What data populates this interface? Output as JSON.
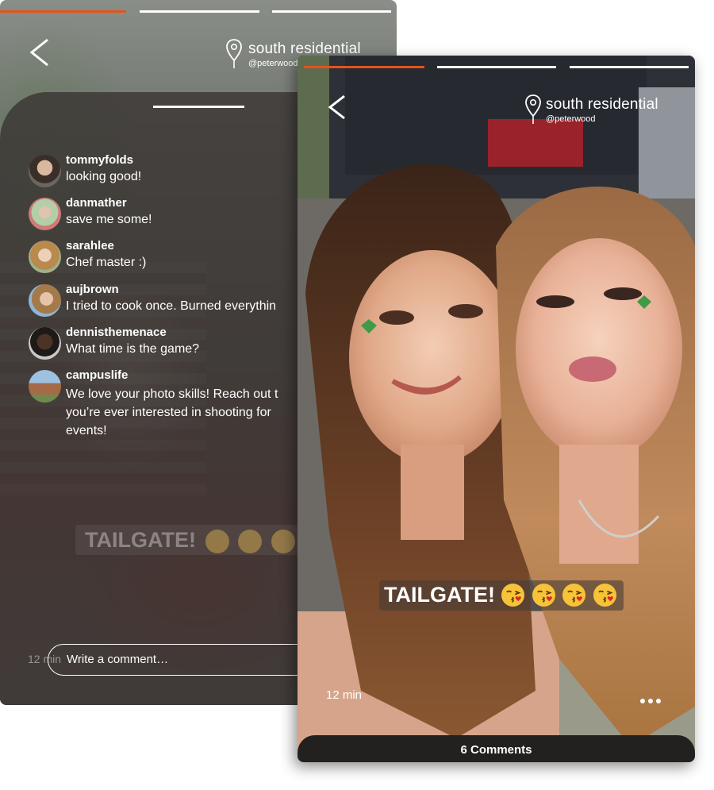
{
  "back_card": {
    "location": {
      "title": "south residential",
      "user": "@peterwood"
    },
    "comments": [
      {
        "username": "tommyfolds",
        "text": "looking good!"
      },
      {
        "username": "danmather",
        "text": "save me some!"
      },
      {
        "username": "sarahlee",
        "text": "Chef master :)"
      },
      {
        "username": "aujbrown",
        "text": "I tried to cook once. Burned everythin"
      },
      {
        "username": "dennisthemenace",
        "text": "What time is the game?"
      },
      {
        "username": "campuslife",
        "text": "We love your photo skills! Reach out t you’re ever interested in shooting for events!"
      }
    ],
    "caption_ghost": "TAILGATE!",
    "time": "12 min",
    "comment_input": {
      "placeholder": "Write a comment…"
    }
  },
  "front_card": {
    "location": {
      "title": "south residential",
      "user": "@peterwood"
    },
    "caption": {
      "text": "TAILGATE!",
      "emoji_count": 4,
      "emoji_name": "face-throwing-kiss-icon"
    },
    "time": "12 min",
    "comments_button": "6 Comments"
  },
  "colors": {
    "progress_active": "#e4531b",
    "progress_inactive": "#ffffff",
    "comments_bar": "#232120"
  },
  "progress": {
    "segments": 3,
    "active_index": 0
  }
}
